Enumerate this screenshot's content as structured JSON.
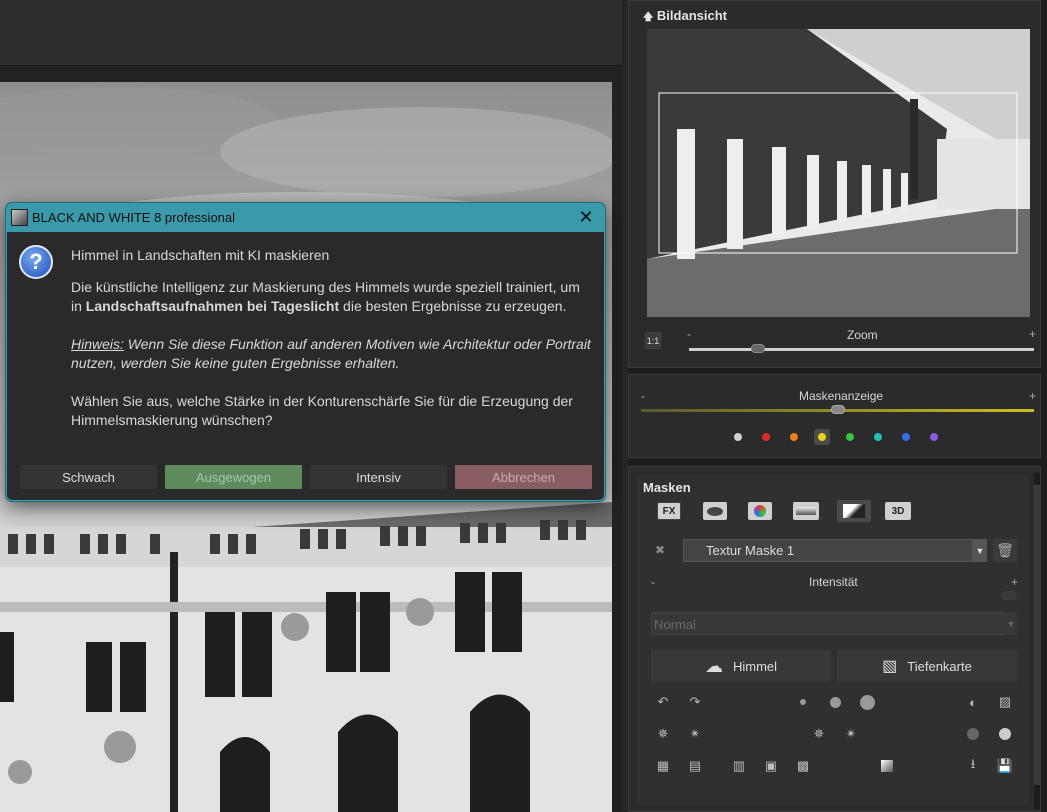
{
  "dialog": {
    "title": "BLACK AND WHITE 8 professional",
    "heading": "Himmel in Landschaften mit KI maskieren",
    "para1_a": "Die künstliche Intelligenz zur Maskierung des Himmels wurde speziell trainiert, um in",
    "para1_bold": "Landschaftsaufnahmen bei Tageslicht",
    "para1_b": " die besten Ergebnisse zu erzeugen.",
    "hint_label": "Hinweis:",
    "hint_text": " Wenn Sie diese Funktion auf anderen Motiven wie Architektur oder Portrait nutzen, werden Sie keine guten Ergebnisse erhalten.",
    "question": "Wählen Sie aus, welche Stärke in der Konturenschärfe Sie für die Erzeugung der Himmelsmaskierung wünschen?",
    "buttons": {
      "weak": "Schwach",
      "balanced": "Ausgewogen",
      "intense": "Intensiv",
      "cancel": "Abbrechen"
    }
  },
  "preview": {
    "title": "Bildansicht",
    "ratio_label": "1:1",
    "zoom_label": "Zoom",
    "zoom_minus": "-",
    "zoom_plus": "+",
    "zoom_value": 0.2
  },
  "mask_display": {
    "label": "Maskenanzeige",
    "minus": "-",
    "plus": "+",
    "value": 0.5,
    "colors": [
      {
        "name": "white",
        "hex": "#d0d0d0"
      },
      {
        "name": "red",
        "hex": "#e02a2a"
      },
      {
        "name": "orange",
        "hex": "#e8801c"
      },
      {
        "name": "yellow",
        "hex": "#e8d21c"
      },
      {
        "name": "green",
        "hex": "#3cc23c"
      },
      {
        "name": "teal",
        "hex": "#22c2b2"
      },
      {
        "name": "blue",
        "hex": "#3a6ee8"
      },
      {
        "name": "purple",
        "hex": "#8a5ae0"
      }
    ],
    "selected_color": "yellow"
  },
  "masks": {
    "title": "Masken",
    "type_tabs": [
      "FX",
      "3D"
    ],
    "mask_select": "Textur Maske 1",
    "intensity_label": "Intensität",
    "intensity_minus": "-",
    "intensity_plus": "+",
    "blend_mode": "Normal",
    "sky_button": "Himmel",
    "depth_button": "Tiefenkarte"
  }
}
